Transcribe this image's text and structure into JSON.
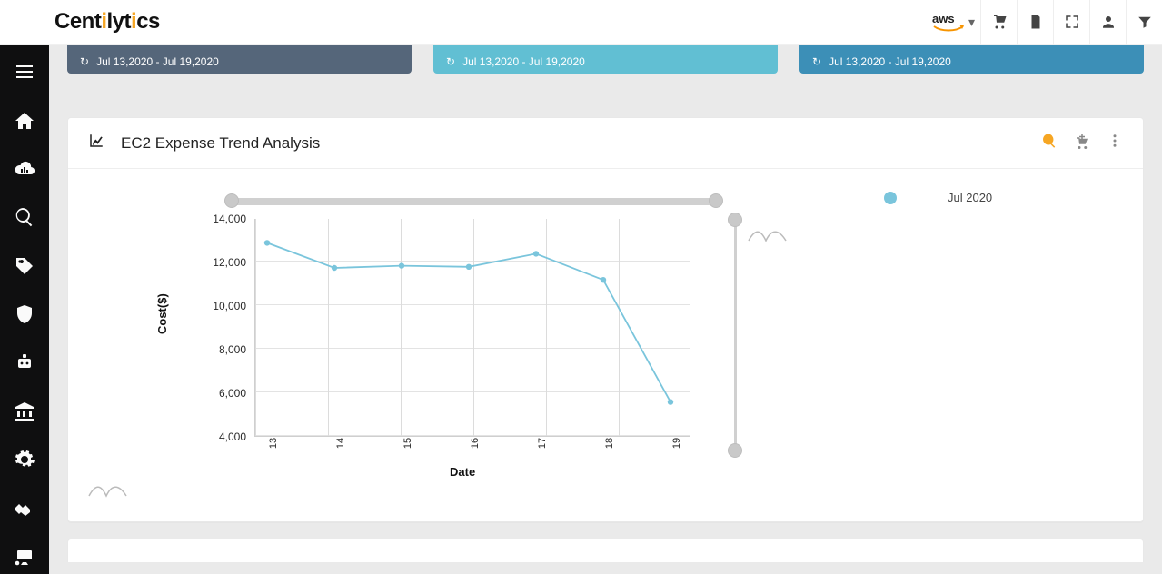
{
  "header": {
    "brand_plain1": "Cent",
    "brand_accent": "i",
    "brand_plain2": "lyt",
    "brand_accent2": "i",
    "brand_plain3": "cs",
    "provider_label": "aws"
  },
  "strips": [
    {
      "date_range": "Jul 13,2020 - Jul 19,2020"
    },
    {
      "date_range": "Jul 13,2020 - Jul 19,2020"
    },
    {
      "date_range": "Jul 13,2020 - Jul 19,2020"
    }
  ],
  "panel": {
    "title": "EC2 Expense Trend Analysis",
    "legend_label": "Jul 2020"
  },
  "chart_data": {
    "type": "line",
    "title": "EC2 Expense Trend Analysis",
    "xlabel": "Date",
    "ylabel": "Cost($)",
    "ylim": [
      4000,
      14000
    ],
    "y_ticks_labels": [
      "4,000",
      "6,000",
      "8,000",
      "10,000",
      "12,000",
      "14,000"
    ],
    "x_ticks_labels": [
      "13",
      "14",
      "15",
      "16",
      "17",
      "18",
      "19"
    ],
    "categories": [
      "13",
      "14",
      "15",
      "16",
      "17",
      "18",
      "19"
    ],
    "series": [
      {
        "name": "Jul 2020",
        "values": [
          12900,
          11750,
          11850,
          11800,
          12400,
          11200,
          5600
        ]
      }
    ]
  }
}
